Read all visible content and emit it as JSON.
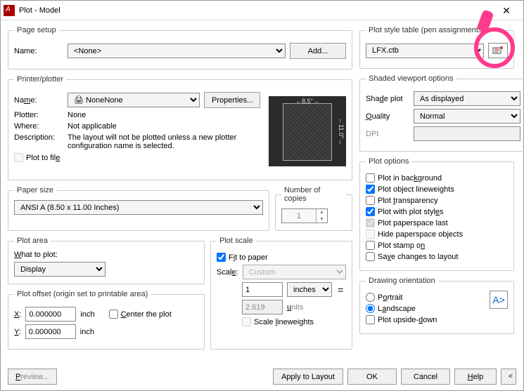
{
  "window": {
    "title": "Plot - Model"
  },
  "pageSetup": {
    "legend": "Page setup",
    "nameLabel": "Name:",
    "nameValue": "<None>",
    "addBtn": "Add..."
  },
  "printer": {
    "legend": "Printer/plotter",
    "nameLabel": "Name:",
    "nameValue": "None",
    "propertiesBtn": "Properties...",
    "plotterLabel": "Plotter:",
    "plotterValue": "None",
    "whereLabel": "Where:",
    "whereValue": "Not applicable",
    "descLabel": "Description:",
    "descValue": "The layout will not be plotted unless a new plotter configuration name is selected.",
    "plotToFile": "Plot to file",
    "preview": {
      "w": "8.5\"",
      "h": "11.0\""
    }
  },
  "paper": {
    "legend": "Paper size",
    "value": "ANSI A (8.50 x 11.00 Inches)"
  },
  "copies": {
    "legend": "Number of copies",
    "value": "1"
  },
  "plotArea": {
    "legend": "Plot area",
    "whatLabel": "What to plot:",
    "value": "Display"
  },
  "plotScale": {
    "legend": "Plot scale",
    "fit": "Fit to paper",
    "scaleLabel": "Scale:",
    "scaleValue": "Custom",
    "num": "1",
    "unit": "inches",
    "den": "2.619",
    "unitsLabel": "units",
    "scaleLW": "Scale lineweights"
  },
  "offset": {
    "legend": "Plot offset (origin set to printable area)",
    "xLabel": "X:",
    "xValue": "0.000000",
    "yLabel": "Y:",
    "yValue": "0.000000",
    "inch": "inch",
    "center": "Center the plot"
  },
  "styleTable": {
    "legend": "Plot style table (pen assignments)",
    "value": "LFX.ctb"
  },
  "shaded": {
    "legend": "Shaded viewport options",
    "shadeLabel": "Shade plot",
    "shadeValue": "As displayed",
    "qualityLabel": "Quality",
    "qualityValue": "Normal",
    "dpiLabel": "DPI"
  },
  "plotOptions": {
    "legend": "Plot options",
    "bg": "Plot in background",
    "lw": "Plot object lineweights",
    "trans": "Plot transparency",
    "styles": "Plot with plot styles",
    "paperspace": "Plot paperspace last",
    "hide": "Hide paperspace objects",
    "stamp": "Plot stamp on",
    "save": "Save changes to layout"
  },
  "orientation": {
    "legend": "Drawing orientation",
    "portrait": "Portrait",
    "landscape": "Landscape",
    "upside": "Plot upside-down"
  },
  "buttons": {
    "preview": "Preview...",
    "apply": "Apply to Layout",
    "ok": "OK",
    "cancel": "Cancel",
    "help": "Help"
  }
}
